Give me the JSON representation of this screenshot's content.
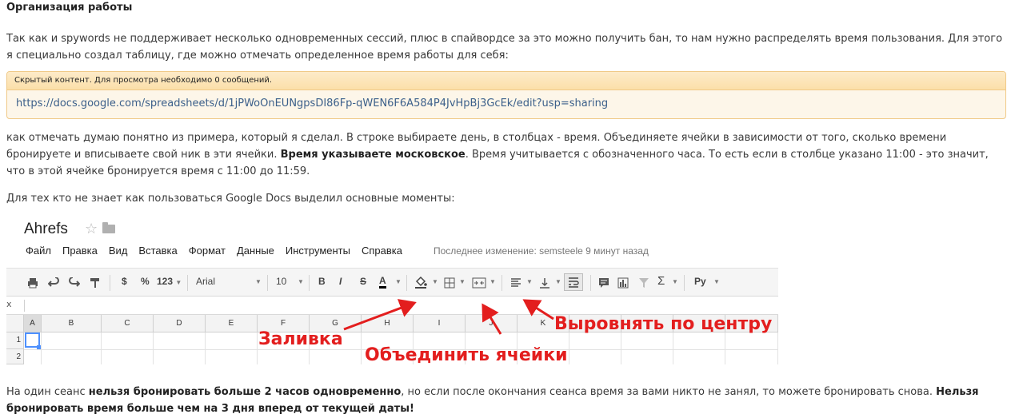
{
  "post": {
    "heading": "Организация работы",
    "intro": "Так как и spywords не поддерживает несколько одновременных сессий, плюс в спайвордсе за это можно получить бан, то нам нужно распределять время пользования. Для этого я специально создал таблицу, где можно отмечать определенное время работы для себя:",
    "hidden_header": "Скрытый контент. Для просмотра необходимо 0 сообщений.",
    "hidden_link": "https://docs.google.com/spreadsheets/d/1jPWoOnEUNgpsDI86Fp-qWEN6F6A584P4JvHpBj3GcEk/edit?usp=sharing",
    "p2_part1": "как отмечать думаю понятно из примера, который я сделал. В строке выбираете день, в столбцах - время. Объединяете ячейки в зависимости от того, сколько времени бронируете и вписываете свой ник в эти ячейки. ",
    "p2_bold": "Время указываете московское",
    "p2_part2": ". Время учитывается с обозначенного часа. То есть если в столбце указано 11:00 - это значит, что в этой ячейке бронируется время с 11:00 до 11:59.",
    "p3": "Для тех кто не знает как пользоваться Google Docs выделил основные моменты:",
    "p4_part1": "На один сеанс ",
    "p4_bold1": "нельзя бронировать больше 2 часов одновременно",
    "p4_part2": ", но если после окончания сеанса время за вами никто не занял, то можете бронировать снова. ",
    "p4_bold2": "Нельзя бронировать время больше чем на 3 дня вперед от текущей даты!"
  },
  "sheet": {
    "title": "Ahrefs",
    "menu": [
      "Файл",
      "Правка",
      "Вид",
      "Вставка",
      "Формат",
      "Данные",
      "Инструменты",
      "Справка"
    ],
    "last_edit": "Последнее изменение: semsteele 9 минут назад",
    "toolbar": {
      "currency": "$",
      "percent": "%",
      "number_format": "123",
      "font": "Arial",
      "size": "10",
      "bold": "B",
      "italic": "I",
      "strike": "S",
      "text_color": "A",
      "more_formats": "Ру"
    },
    "formula_bar_label": "x",
    "columns": [
      "A",
      "B",
      "C",
      "D",
      "E",
      "F",
      "G",
      "H",
      "I",
      "J",
      "K"
    ],
    "rows": [
      "1",
      "2"
    ]
  },
  "annotations": {
    "fill": "Заливка",
    "merge": "Объединить ячейки",
    "align": "Выровнять по центру",
    "color": "#e31e1e"
  }
}
